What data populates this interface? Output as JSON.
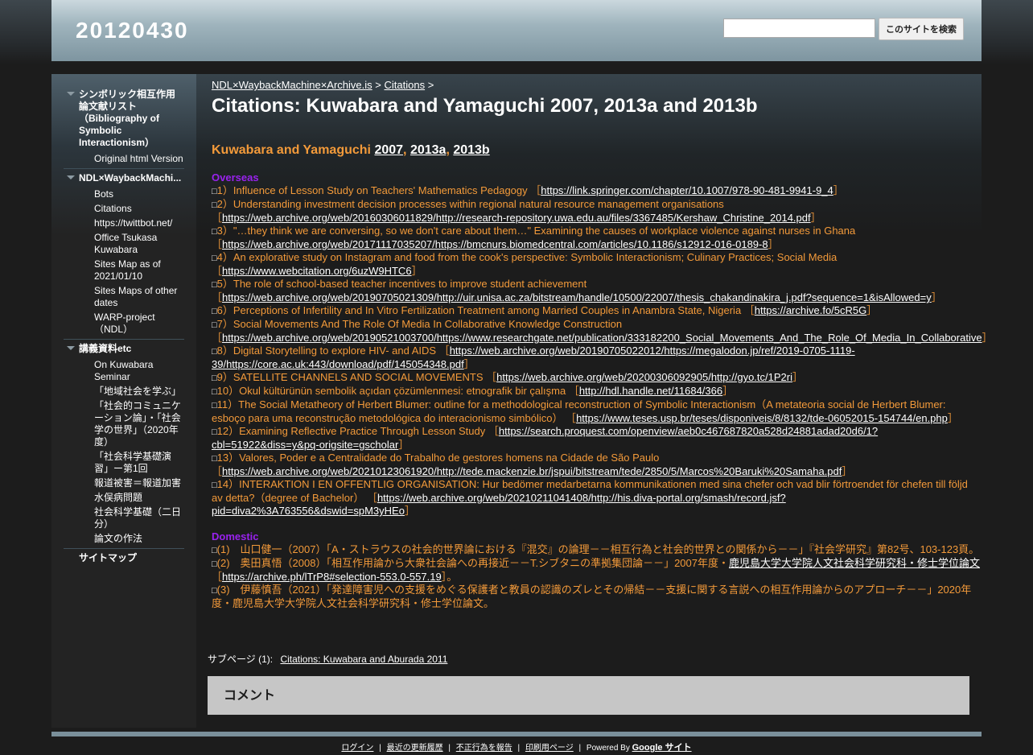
{
  "site": {
    "title": "20120430"
  },
  "search": {
    "placeholder": "",
    "button": "このサイトを検索"
  },
  "sidebar": {
    "sections": [
      {
        "label": "シンボリック相互作用論文献リスト（Bibliography of Symbolic Interactionism）",
        "items": [
          "Original html Version"
        ]
      },
      {
        "label": "NDL×WaybackMachi...",
        "items": [
          "Bots",
          "Citations",
          "https://twittbot.net/",
          "Office Tsukasa Kuwabara",
          "Sites Map as of 2021/01/10",
          "Sites Maps of other dates",
          "WARP-project（NDL）"
        ]
      },
      {
        "label": "講義資料etc",
        "items": [
          "On Kuwabara Seminar",
          "「地域社会を学ぶ」",
          "「社会的コミュニケーション論」・「社会学の世界」（2020年度）",
          "「社会科学基礎演習」ー第1回",
          "報道被害＝報道加害",
          "水俣病問題",
          "社会科学基礎（二日分）",
          "論文の作法"
        ]
      },
      {
        "label": "サイトマップ",
        "items": []
      }
    ]
  },
  "breadcrumb": {
    "root": "NDL×WaybackMachine×Archive.is",
    "sep": ">",
    "parent": "Citations"
  },
  "page": {
    "title": "Citations: Kuwabara and Yamaguchi 2007, 2013a and 2013b",
    "subtitle_text": "Kuwabara and Yamaguchi",
    "subtitle_links": [
      "2007",
      "2013a",
      "2013b"
    ],
    "overseas_heading": "Overseas",
    "overseas": [
      {
        "text": "1）Influence of Lesson Study on Teachers' Mathematics Pedagogy ［",
        "link": "https://link.springer.com/chapter/10.1007/978-90-481-9941-9_4"
      },
      {
        "text": "2）Understanding investment decision processes within regional natural resource management organisations ［",
        "link": "https://web.archive.org/web/20160306011829/http://research-repository.uwa.edu.au/files/3367485/Kershaw_Christine_2014.pdf"
      },
      {
        "text": "3）\"…they think we are conversing, so we don't care about them…\" Examining the causes of workplace violence against nurses in Ghana ［",
        "link": "https://web.archive.org/web/20171117035207/https://bmcnurs.biomedcentral.com/articles/10.1186/s12912-016-0189-8"
      },
      {
        "text": "4）An explorative study on Instagram and food from the cook's perspective: Symbolic Interactionism; Culinary Practices; Social Media ［",
        "link": "https://www.webcitation.org/6uzW9HTC6"
      },
      {
        "text": "5）The role of school-based teacher incentives to improve student achievement ［",
        "link": "https://web.archive.org/web/20190705021309/http://uir.unisa.ac.za/bitstream/handle/10500/22007/thesis_chakandinakira_j.pdf?sequence=1&isAllowed=y"
      },
      {
        "text": "6）Perceptions of Infertility and In Vitro Fertilization Treatment among Married Couples in Anambra State, Nigeria ［",
        "link": "https://archive.fo/5cR5G"
      },
      {
        "text": "7）Social Movements And The Role Of Media In Collaborative Knowledge Construction ［",
        "link": "https://web.archive.org/web/20190521003700/https://www.researchgate.net/publication/333182200_Social_Movements_And_The_Role_Of_Media_In_Collaborative"
      },
      {
        "text": "8）Digital Storytelling to explore HIV- and AIDS ［",
        "link": "https://web.archive.org/web/20190705022012/https://megalodon.jp/ref/2019-0705-1119-39/https://core.ac.uk:443/download/pdf/145054348.pdf"
      },
      {
        "text": "9）SATELLITE CHANNELS AND SOCIAL MOVEMENTS ［",
        "link": "https://web.archive.org/web/20200306092905/http://gyo.tc/1P2ri"
      },
      {
        "text": "10）Okul kültürünün sembolik açıdan çözümlenmesi: etnografik bir çalışma ［",
        "link": "http://hdl.handle.net/11684/366"
      },
      {
        "text": "11）The Social Metatheory of Herbert Blumer: outline for a methodological reconstruction of Symbolic Interactionism（A metateoria social de Herbert Blumer: esboço para uma reconstrução metodológica do interacionismo simbólico） ［",
        "link": "https://www.teses.usp.br/teses/disponiveis/8/8132/tde-06052015-154744/en.php"
      },
      {
        "text": "12）Examining Reflective Practice Through Lesson Study ［",
        "link": "https://search.proquest.com/openview/aeb0c467687820a528d24881adad20d6/1?cbl=51922&diss=y&pq-origsite=gscholar"
      },
      {
        "text": "13）Valores, Poder e a Centralidade do Trabalho de gestores homens na Cidade de São Paulo ［",
        "link": "https://web.archive.org/web/20210123061920/http://tede.mackenzie.br/jspui/bitstream/tede/2850/5/Marcos%20Baruki%20Samaha.pdf"
      },
      {
        "text": "14）INTERAKTION I EN OFFENTLIG ORGANISATION: Hur bedömer medarbetarna kommunikationen med sina chefer och vad blir förtroendet för chefen till följd av detta?（degree of Bachelor） ［",
        "link": "https://web.archive.org/web/20210211041408/http://his.diva-portal.org/smash/record.jsf?pid=diva2%3A763556&dswid=spM3yHEo"
      }
    ],
    "domestic_heading": "Domestic",
    "domestic": [
      {
        "text": "(1)　山口健一（2007）「A・ストラウスの社会的世界論における『混交』の論理－－相互行為と社会的世界との関係から－－」『社会学研究』第82号、103-123頁。"
      },
      {
        "text": "(2)　奥田真悟（2008）「相互作用論から大衆社会論への再接近－－T.シブタニの準拠集団論－－」2007年度・",
        "link_text": "鹿児島大学大学院人文社会科学研究科・修士学位論文",
        "tail": "［",
        "link": "https://archive.ph/lTrP8#selection-553.0-557.19",
        "end": "］。"
      },
      {
        "text": "(3)　伊藤慎吾（2021）「発達障害児への支援をめぐる保護者と教員の認識のズレとその帰結－－支援に関する言説への相互作用論からのアプローチ－－」2020年度・鹿児島大学大学院人文社会科学研究科・修士学位論文。"
      }
    ],
    "close_bracket": "］",
    "box": "□"
  },
  "subpages": {
    "label": "サブページ (1):",
    "link": "Citations: Kuwabara and Aburada 2011"
  },
  "comments": {
    "title": "コメント"
  },
  "footer": {
    "links": [
      "ログイン",
      "最近の更新履歴",
      "不正行為を報告",
      "印刷用ページ"
    ],
    "powered": "Powered By",
    "google": "Google サイト",
    "sep": "|"
  }
}
